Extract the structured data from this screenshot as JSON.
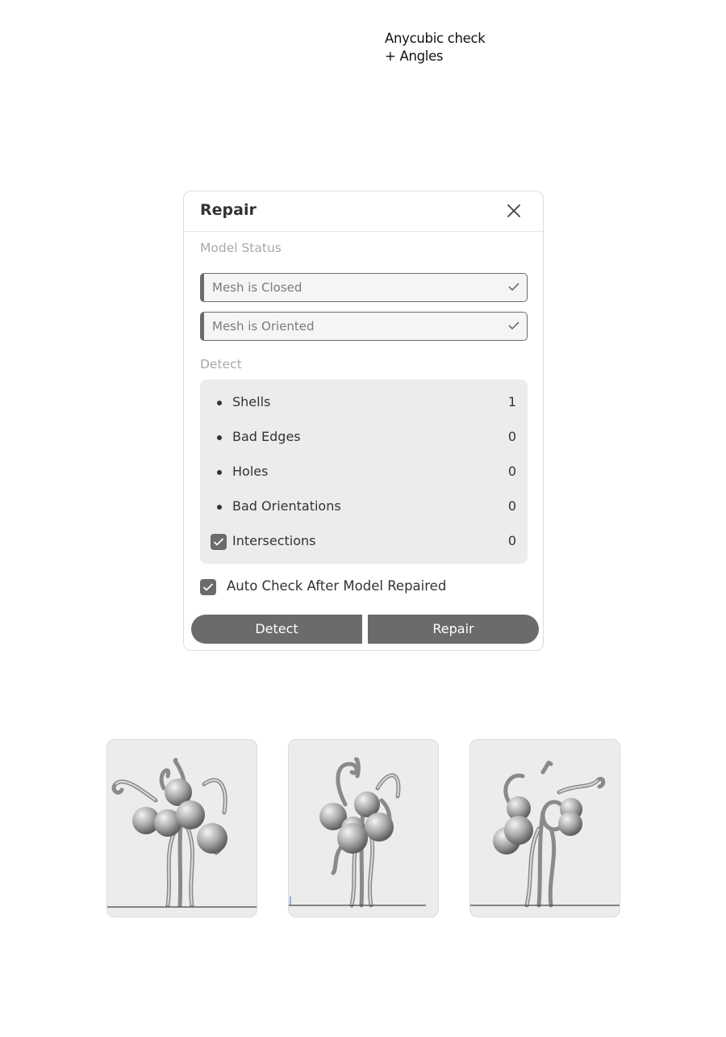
{
  "caption": {
    "line1": "Anycubic check",
    "line2": "+ Angles"
  },
  "dialog": {
    "title": "Repair",
    "close_icon": "close-icon",
    "model_status_label": "Model Status",
    "status_items": [
      {
        "label": "Mesh is Closed",
        "icon": "checkmark-icon"
      },
      {
        "label": "Mesh is Oriented",
        "icon": "checkmark-icon"
      }
    ],
    "detect_label": "Detect",
    "detect_items": [
      {
        "label": "Shells",
        "value": "1"
      },
      {
        "label": "Bad Edges",
        "value": "0"
      },
      {
        "label": "Holes",
        "value": "0"
      },
      {
        "label": "Bad Orientations",
        "value": "0"
      },
      {
        "label": "Intersections",
        "value": "0",
        "checked": true
      }
    ],
    "auto_check": {
      "label": "Auto Check After Model Repaired",
      "checked": true
    },
    "buttons": {
      "detect": "Detect",
      "repair": "Repair"
    }
  },
  "thumbnails": [
    {
      "name": "model-view-front"
    },
    {
      "name": "model-view-side"
    },
    {
      "name": "model-view-back"
    }
  ],
  "colors": {
    "accent": "#6b6b6b",
    "panel": "#ececec",
    "muted_text": "#a8a8a8",
    "text": "#333333"
  }
}
